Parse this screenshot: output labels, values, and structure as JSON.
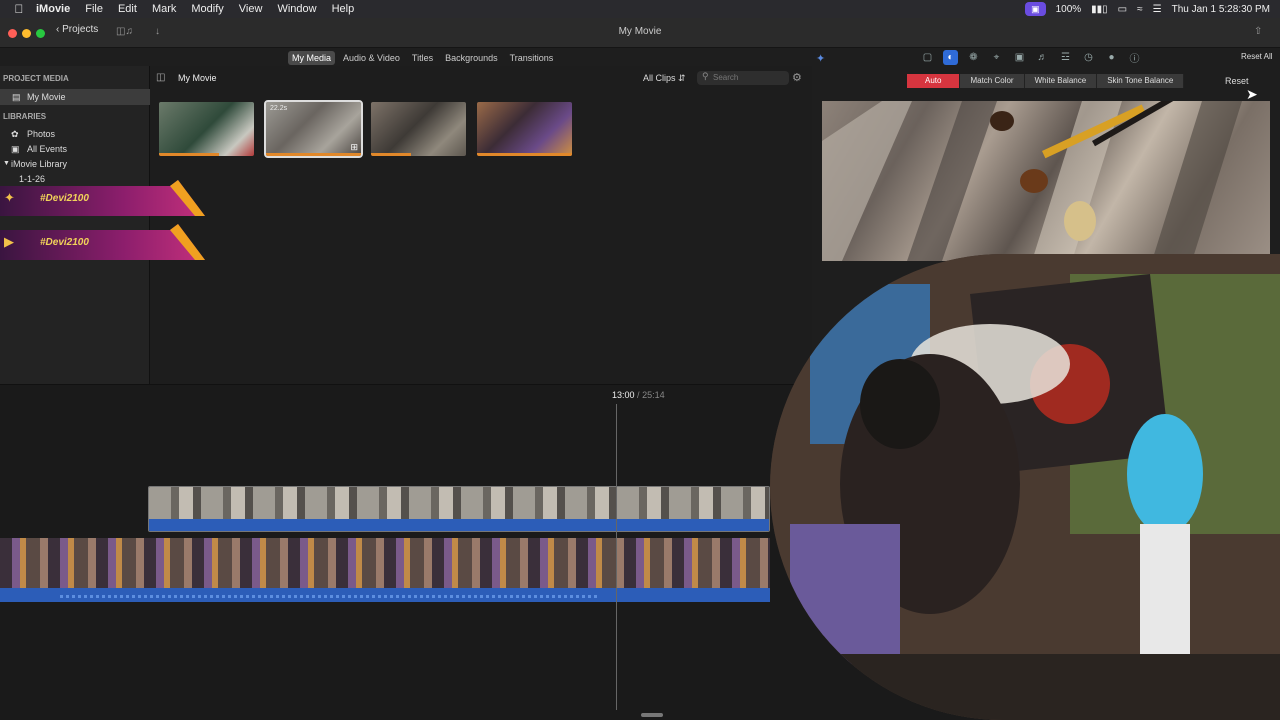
{
  "menubar": {
    "app": "iMovie",
    "items": [
      "File",
      "Edit",
      "Mark",
      "Modify",
      "View",
      "Window",
      "Help"
    ],
    "battery": "100%",
    "clock": "Thu Jan 1  5:28:30 PM"
  },
  "toolbar": {
    "projects_label": "Projects",
    "window_title": "My Movie"
  },
  "media_tabs": [
    "My Media",
    "Audio & Video",
    "Titles",
    "Backgrounds",
    "Transitions"
  ],
  "sidebar": {
    "project_media_header": "PROJECT MEDIA",
    "project_item": "My Movie",
    "libraries_header": "LIBRARIES",
    "photos": "Photos",
    "all_events": "All Events",
    "library": "iMovie Library",
    "event": "1-1-26"
  },
  "browser": {
    "title": "My Movie",
    "filter": "All Clips",
    "search_placeholder": "Search",
    "thumb_duration": "22.2s"
  },
  "banners": [
    "#Devi2100",
    "#Devi2100"
  ],
  "viewer": {
    "reset_all": "Reset All",
    "color_options": [
      "Auto",
      "Match Color",
      "White Balance",
      "Skin Tone Balance"
    ],
    "reset": "Reset"
  },
  "timeline": {
    "current": "13:00",
    "separator": "/",
    "total": "25:14"
  },
  "colors": {
    "accent_blue": "#2f6bd7",
    "auto_red": "#d6353f",
    "clip_blue": "#2c5db8",
    "thumb_orange": "#e1882a"
  }
}
